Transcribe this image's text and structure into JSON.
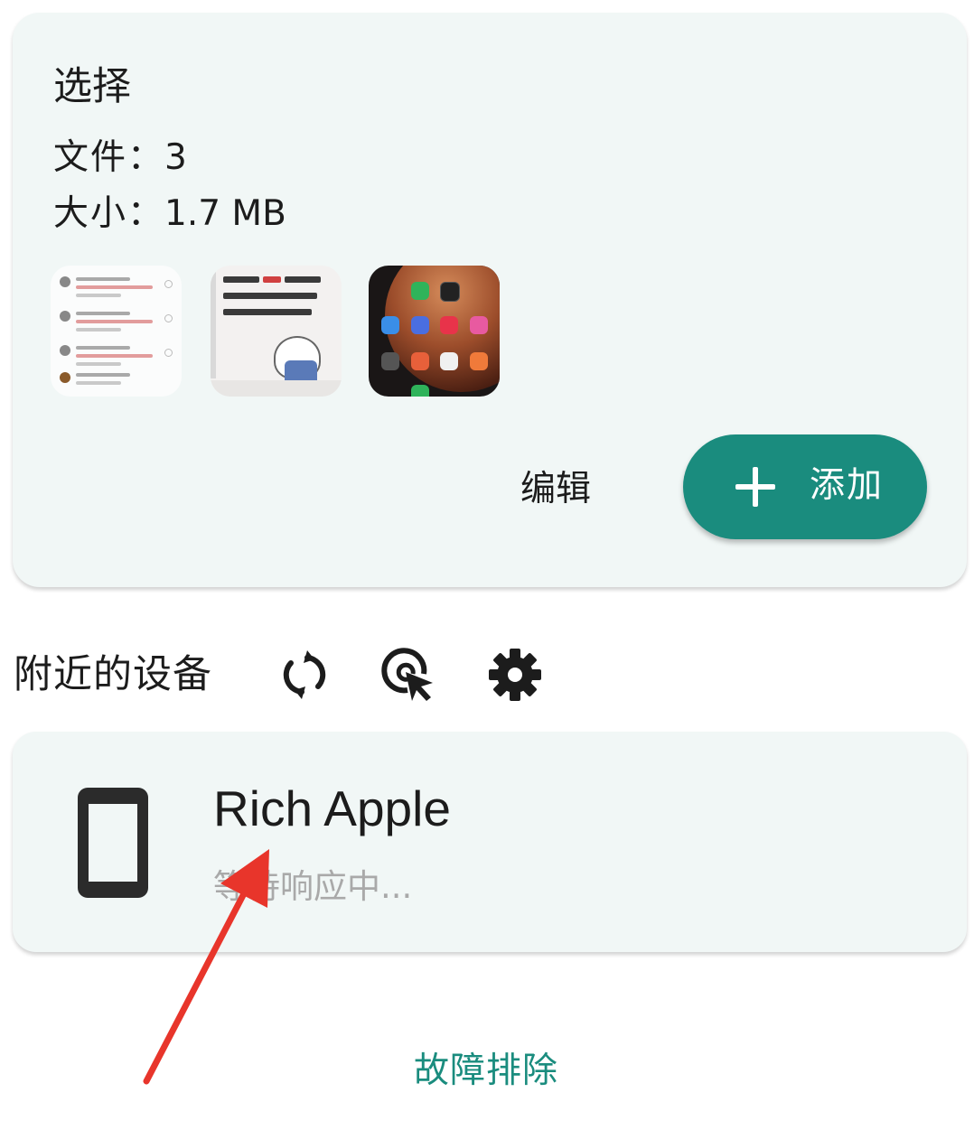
{
  "selection": {
    "title": "选择",
    "files_label": "文件：",
    "files_value": "3",
    "size_label": "大小：",
    "size_value": "1.7 MB",
    "edit_label": "编辑",
    "add_label": "添加"
  },
  "nearby": {
    "title": "附近的设备",
    "icons": [
      "refresh-icon",
      "select-cursor-icon",
      "gear-icon"
    ]
  },
  "device": {
    "name": "Rich Apple",
    "status": "等待响应中...",
    "icon": "phone-icon"
  },
  "troubleshoot_label": "故障排除",
  "colors": {
    "accent": "#1a8c7e",
    "card_bg": "#f1f7f6",
    "annotation": "#e8352b"
  }
}
